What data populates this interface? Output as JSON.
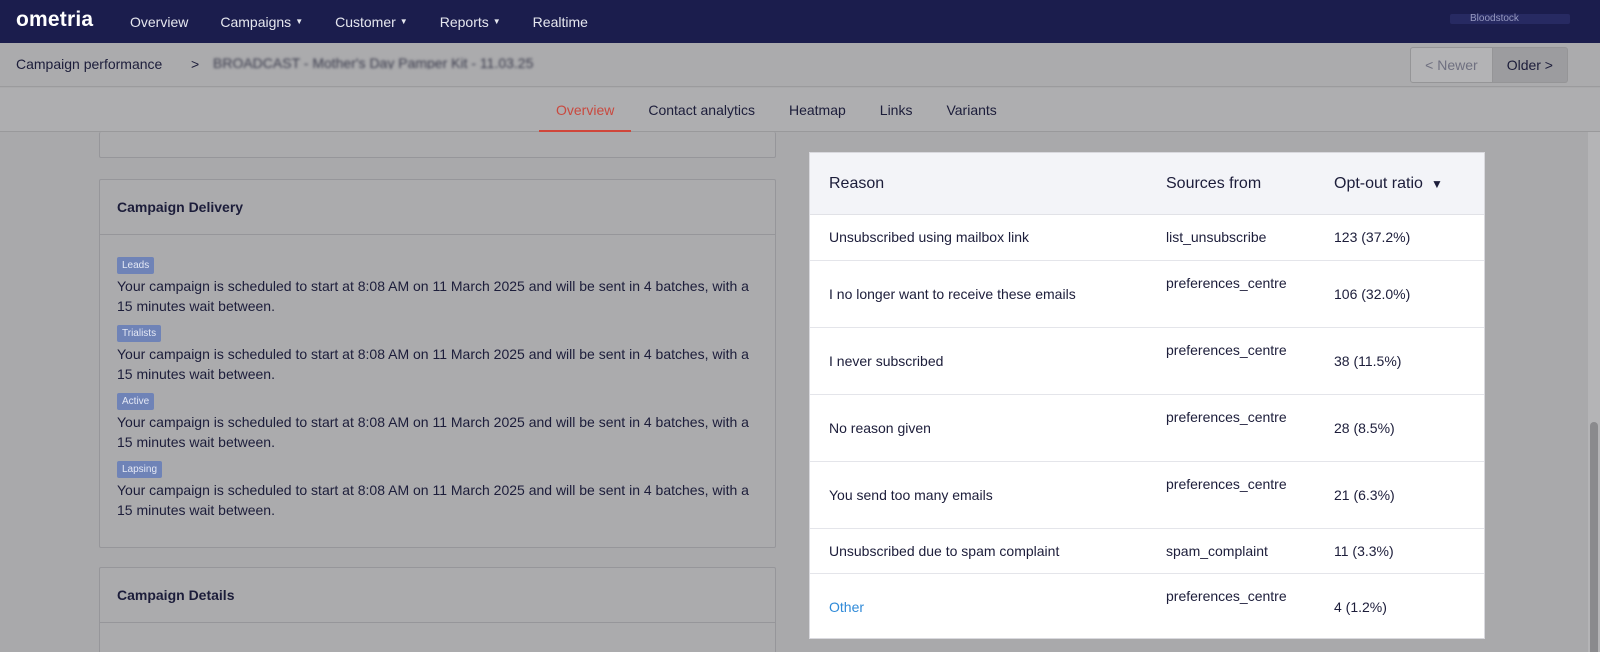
{
  "app": {
    "logo": "ometria"
  },
  "nav": {
    "items": [
      {
        "label": "Overview",
        "caret": false
      },
      {
        "label": "Campaigns",
        "caret": true
      },
      {
        "label": "Customer",
        "caret": true
      },
      {
        "label": "Reports",
        "caret": true
      },
      {
        "label": "Realtime",
        "caret": false
      }
    ],
    "user_label": "Bloodstock"
  },
  "breadcrumb": {
    "root": "Campaign performance",
    "separator": ">",
    "current": "BROADCAST - Mother's Day Pamper Kit - 11.03.25"
  },
  "pager": {
    "newer": "< Newer",
    "older": "Older >"
  },
  "tabs": [
    {
      "label": "Overview",
      "active": true
    },
    {
      "label": "Contact analytics",
      "active": false
    },
    {
      "label": "Heatmap",
      "active": false
    },
    {
      "label": "Links",
      "active": false
    },
    {
      "label": "Variants",
      "active": false
    }
  ],
  "delivery": {
    "title": "Campaign Delivery",
    "batches": [
      {
        "tag": "Leads",
        "text": "Your campaign is scheduled to start at 8:08 AM on 11 March 2025 and will be sent in 4 batches, with a 15 minutes wait between."
      },
      {
        "tag": "Trialists",
        "text": "Your campaign is scheduled to start at 8:08 AM on 11 March 2025 and will be sent in 4 batches, with a 15 minutes wait between."
      },
      {
        "tag": "Active",
        "text": "Your campaign is scheduled to start at 8:08 AM on 11 March 2025 and will be sent in 4 batches, with a 15 minutes wait between."
      },
      {
        "tag": "Lapsing",
        "text": "Your campaign is scheduled to start at 8:08 AM on 11 March 2025 and will be sent in 4 batches, with a 15 minutes wait between."
      }
    ]
  },
  "details": {
    "title": "Campaign Details"
  },
  "optout_table": {
    "headers": {
      "reason": "Reason",
      "source": "Sources from",
      "ratio": "Opt-out ratio",
      "sort_icon": "▼"
    },
    "rows": [
      {
        "reason": "Unsubscribed using mailbox link",
        "source": "list_unsubscribe",
        "ratio": "123 (37.2%)",
        "link": false
      },
      {
        "reason": "I no longer want to receive these emails",
        "source": "preferences_centre",
        "ratio": "106 (32.0%)",
        "link": false
      },
      {
        "reason": "I never subscribed",
        "source": "preferences_centre",
        "ratio": "38 (11.5%)",
        "link": false
      },
      {
        "reason": "No reason given",
        "source": "preferences_centre",
        "ratio": "28 (8.5%)",
        "link": false
      },
      {
        "reason": "You send too many emails",
        "source": "preferences_centre",
        "ratio": "21 (6.3%)",
        "link": false
      },
      {
        "reason": "Unsubscribed due to spam complaint",
        "source": "spam_complaint",
        "ratio": "11 (3.3%)",
        "link": false
      },
      {
        "reason": "Other",
        "source": "preferences_centre",
        "ratio": "4 (1.2%)",
        "link": true
      }
    ]
  },
  "colors": {
    "nav_bg": "#1b1d4d",
    "accent_red": "#d0463a",
    "link_blue": "#2f8ad8",
    "tag_bg": "#6f83b7"
  }
}
